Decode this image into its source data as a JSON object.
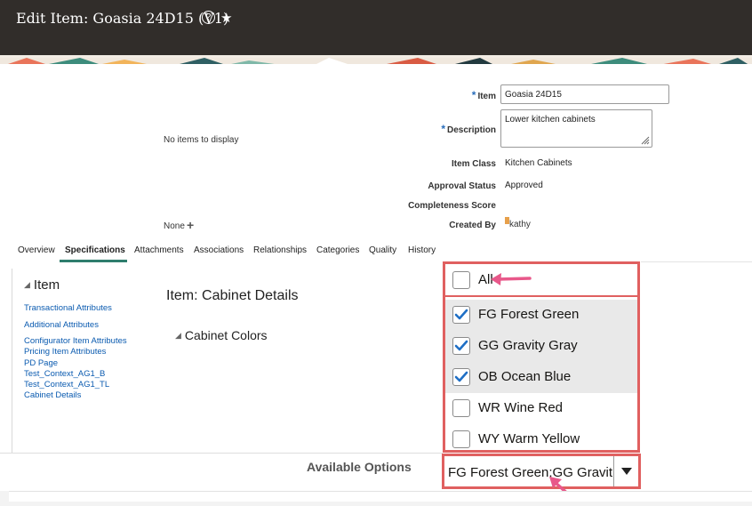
{
  "header": {
    "title": "Edit Item: Goasia 24D15 (V1)",
    "help_glyph": "?",
    "star_glyph": "★"
  },
  "summary": {
    "item_label": "Item",
    "item_value": "Goasia 24D15",
    "description_label": "Description",
    "description_value": "Lower kitchen cabinets",
    "item_class_label": "Item Class",
    "item_class_value": "Kitchen Cabinets",
    "approval_status_label": "Approval Status",
    "approval_status_value": "Approved",
    "completeness_label": "Completeness Score",
    "created_by_label": "Created By",
    "created_by_value": "kathy",
    "no_items": "No items to display",
    "none_label": "None",
    "required_mark": "*",
    "plus_glyph": "+"
  },
  "tabs": [
    {
      "label": "Overview",
      "active": false
    },
    {
      "label": "Specifications",
      "active": true
    },
    {
      "label": "Attachments",
      "active": false
    },
    {
      "label": "Associations",
      "active": false
    },
    {
      "label": "Relationships",
      "active": false
    },
    {
      "label": "Categories",
      "active": false
    },
    {
      "label": "Quality",
      "active": false
    },
    {
      "label": "History",
      "active": false
    }
  ],
  "left_panel": {
    "header": "Item",
    "links": [
      "Transactional Attributes",
      "Additional Attributes",
      "Configurator Item Attributes",
      "Pricing Item Attributes",
      "PD Page",
      "Test_Context_AG1_B",
      "Test_Context_AG1_TL",
      "Cabinet Details"
    ]
  },
  "main": {
    "section_title": "Item: Cabinet Details",
    "subsection_title": "Cabinet Colors",
    "available_options_label": "Available Options",
    "select_value": "FG Forest Green;GG Gravit"
  },
  "dropdown": {
    "all_label": "All",
    "all_checked": false,
    "options": [
      {
        "label": "FG Forest Green",
        "checked": true
      },
      {
        "label": "GG Gravity Gray",
        "checked": true
      },
      {
        "label": "OB Ocean Blue",
        "checked": true
      },
      {
        "label": "WR Wine Red",
        "checked": false
      },
      {
        "label": "WY Warm Yellow",
        "checked": false
      }
    ]
  },
  "colors": {
    "header_bg": "#312d2a",
    "accent": "#2e7d6d",
    "link": "#0b5bb0",
    "highlight_border": "#e06060",
    "arrow": "#e8588a",
    "check": "#1f6fc5"
  }
}
